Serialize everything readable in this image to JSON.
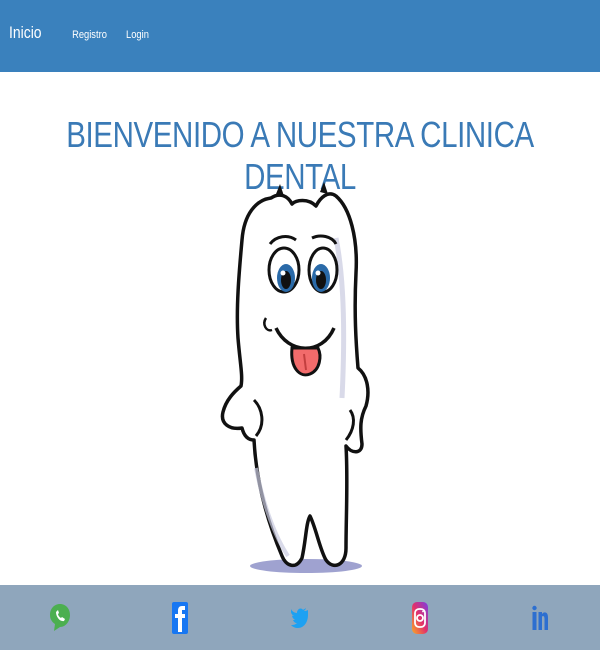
{
  "navbar": {
    "brand": "Inicio",
    "links": [
      {
        "label": "Registro"
      },
      {
        "label": "Login"
      }
    ]
  },
  "main": {
    "title": "BIENVENIDO A NUESTRA CLINICA DENTAL",
    "illustration": "smiling-tooth-cartoon"
  },
  "footer": {
    "social": [
      {
        "icon": "whatsapp-icon",
        "color": "#4caf50"
      },
      {
        "icon": "facebook-icon",
        "color": "#1877f2"
      },
      {
        "icon": "twitter-icon",
        "color": "#1da1f2"
      },
      {
        "icon": "instagram-icon",
        "color": "#e1306c"
      },
      {
        "icon": "linkedin-icon",
        "color": "#2d6fd0"
      }
    ]
  },
  "colors": {
    "navbar": "#3a81bd",
    "title": "#3a7ab6",
    "footer": "#8fa6bc"
  }
}
